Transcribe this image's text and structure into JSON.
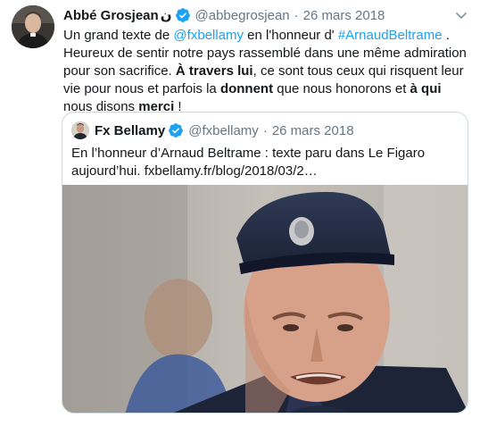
{
  "tweet": {
    "author": {
      "display_name": "Abbé Grosjean",
      "name_symbol": "ن",
      "handle": "@abbegrosjean",
      "verified": true
    },
    "separator": "·",
    "date": "26 mars 2018",
    "text_parts": {
      "p1": "Un grand texte de ",
      "mention": "@fxbellamy",
      "p2": " en l'honneur d' ",
      "hashtag": "#ArnaudBeltrame",
      "p3": " . Heureux de sentir notre pays rassemblé dans une même admiration pour son sacrifice. ",
      "b1": "À travers lui",
      "p4": ", ce sont tous ceux qui risquent leur vie pour nous et parfois la ",
      "b2": "donnent",
      "p5": " que nous honorons et ",
      "b3": "à qui",
      "p6": " nous disons ",
      "b4": "merci",
      "p7": " !"
    },
    "quoted": {
      "author": {
        "display_name": "Fx Bellamy",
        "handle": "@fxbellamy",
        "verified": true
      },
      "separator": "·",
      "date": "26 mars 2018",
      "text": "En l’honneur d’Arnaud Beltrame : texte paru dans Le Figaro aujourd’hui. fxbellamy.fr/blog/2018/03/2…"
    },
    "menu_icon": "chevron-down-icon",
    "colors": {
      "link": "#1da1f2",
      "verified": "#1da1f2",
      "muted": "#657786",
      "border": "#ccd6dd"
    }
  }
}
